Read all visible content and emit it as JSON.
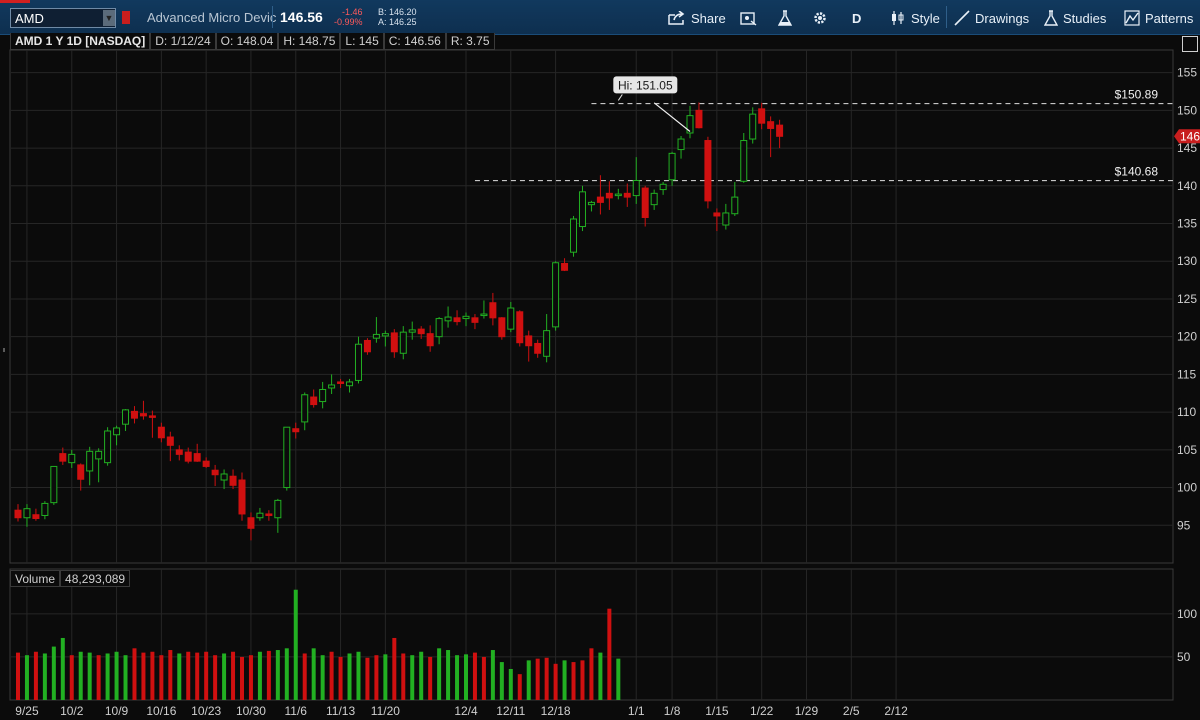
{
  "toolbar": {
    "symbol": "AMD",
    "description": "Advanced Micro Devic",
    "last": "146.56",
    "change": "-1.46",
    "change_pct": "-0.99%",
    "bid": "B: 146.20",
    "ask": "A: 146.25",
    "share_label": "Share",
    "aggregation_label": "D",
    "style_label": "Style",
    "drawings_label": "Drawings",
    "studies_label": "Studies",
    "patterns_label": "Patterns"
  },
  "info": {
    "title": "AMD 1 Y 1D [NASDAQ]",
    "date": "D: 1/12/24",
    "open": "O: 148.04",
    "high": "H: 148.75",
    "low": "L: 145",
    "close": "C: 146.56",
    "range": "R: 3.75"
  },
  "volume": {
    "label": "Volume",
    "value": "48,293,089"
  },
  "colors": {
    "up": "#22b022",
    "down": "#d01010",
    "grid": "#262626",
    "background": "#0b0b0b",
    "last_price_tag": "#c81e1e"
  },
  "chart_data": {
    "type": "candlestick",
    "price_ylim": [
      90,
      158
    ],
    "price_ticks": [
      95,
      100,
      105,
      110,
      115,
      120,
      125,
      130,
      135,
      140,
      145,
      150,
      155
    ],
    "volume_ylim": [
      0,
      130
    ],
    "volume_ticks": [
      50,
      100
    ],
    "x_tick_labels": [
      "9/25",
      "10/2",
      "10/9",
      "10/16",
      "10/23",
      "10/30",
      "11/6",
      "11/13",
      "11/20",
      "12/4",
      "12/11",
      "12/18",
      "1/1",
      "1/8",
      "1/15",
      "1/22",
      "1/29",
      "2/5",
      "2/12"
    ],
    "x_tick_index": [
      1,
      6,
      11,
      16,
      21,
      26,
      31,
      36,
      41,
      50,
      55,
      60,
      69,
      73,
      78,
      83,
      88,
      93,
      98
    ],
    "grid": true,
    "last_price_label": "146",
    "annotations": {
      "hi_label": "Hi: 151.05",
      "hi_value": 151.05,
      "hi_index": 67,
      "level_1_label": "$150.89",
      "level_1_value": 150.89,
      "level_1_start_index": 64,
      "level_2_label": "$140.68",
      "level_2_value": 140.68,
      "level_2_start_index": 51,
      "trendline": [
        [
          71,
          151.0
        ],
        [
          75,
          147.2
        ]
      ]
    },
    "candles": [
      {
        "o": 97.0,
        "h": 97.8,
        "l": 95.5,
        "c": 96.0
      },
      {
        "o": 96.0,
        "h": 97.8,
        "l": 94.8,
        "c": 97.2
      },
      {
        "o": 96.4,
        "h": 97.2,
        "l": 95.6,
        "c": 95.9
      },
      {
        "o": 96.3,
        "h": 98.2,
        "l": 95.8,
        "c": 97.9
      },
      {
        "o": 98.0,
        "h": 101.5,
        "l": 97.7,
        "c": 102.8
      },
      {
        "o": 104.5,
        "h": 105.3,
        "l": 103.0,
        "c": 103.5
      },
      {
        "o": 103.3,
        "h": 105.0,
        "l": 102.6,
        "c": 104.4
      },
      {
        "o": 103.0,
        "h": 103.2,
        "l": 99.6,
        "c": 101.1
      },
      {
        "o": 102.2,
        "h": 105.4,
        "l": 100.3,
        "c": 104.8
      },
      {
        "o": 103.8,
        "h": 105.2,
        "l": 100.7,
        "c": 104.8
      },
      {
        "o": 103.3,
        "h": 108.0,
        "l": 102.9,
        "c": 107.5
      },
      {
        "o": 107.0,
        "h": 108.2,
        "l": 105.6,
        "c": 107.9
      },
      {
        "o": 108.4,
        "h": 110.4,
        "l": 107.5,
        "c": 110.3
      },
      {
        "o": 110.1,
        "h": 110.8,
        "l": 108.5,
        "c": 109.2
      },
      {
        "o": 109.8,
        "h": 111.5,
        "l": 109.0,
        "c": 109.5
      },
      {
        "o": 109.5,
        "h": 110.2,
        "l": 106.6,
        "c": 109.4
      },
      {
        "o": 108.0,
        "h": 108.6,
        "l": 106.0,
        "c": 106.6
      },
      {
        "o": 106.7,
        "h": 107.4,
        "l": 103.5,
        "c": 105.6
      },
      {
        "o": 105.0,
        "h": 105.6,
        "l": 103.6,
        "c": 104.4
      },
      {
        "o": 104.7,
        "h": 105.3,
        "l": 103.2,
        "c": 103.5
      },
      {
        "o": 104.5,
        "h": 105.8,
        "l": 103.4,
        "c": 103.5
      },
      {
        "o": 103.5,
        "h": 104.0,
        "l": 102.6,
        "c": 102.8
      },
      {
        "o": 102.3,
        "h": 103.0,
        "l": 100.2,
        "c": 101.7
      },
      {
        "o": 101.0,
        "h": 102.4,
        "l": 99.8,
        "c": 101.8
      },
      {
        "o": 101.5,
        "h": 102.4,
        "l": 99.8,
        "c": 100.3
      },
      {
        "o": 101.0,
        "h": 102.0,
        "l": 95.6,
        "c": 96.5
      },
      {
        "o": 96.0,
        "h": 96.7,
        "l": 93.0,
        "c": 94.6
      },
      {
        "o": 96.0,
        "h": 97.3,
        "l": 95.6,
        "c": 96.6
      },
      {
        "o": 96.5,
        "h": 97.0,
        "l": 95.6,
        "c": 96.3
      },
      {
        "o": 96.0,
        "h": 98.5,
        "l": 94.0,
        "c": 98.3
      },
      {
        "o": 100.0,
        "h": 108.0,
        "l": 99.6,
        "c": 108.0
      },
      {
        "o": 107.8,
        "h": 108.6,
        "l": 106.5,
        "c": 107.4
      },
      {
        "o": 108.7,
        "h": 112.6,
        "l": 107.6,
        "c": 112.3
      },
      {
        "o": 112.0,
        "h": 113.0,
        "l": 110.6,
        "c": 111.0
      },
      {
        "o": 111.4,
        "h": 114.0,
        "l": 110.5,
        "c": 113.0
      },
      {
        "o": 113.2,
        "h": 115.0,
        "l": 112.4,
        "c": 113.6
      },
      {
        "o": 114.0,
        "h": 114.4,
        "l": 113.2,
        "c": 113.8
      },
      {
        "o": 113.5,
        "h": 114.4,
        "l": 112.6,
        "c": 114.0
      },
      {
        "o": 114.2,
        "h": 120.0,
        "l": 113.8,
        "c": 119.0
      },
      {
        "o": 119.5,
        "h": 119.8,
        "l": 117.6,
        "c": 118.0
      },
      {
        "o": 119.8,
        "h": 122.6,
        "l": 119.2,
        "c": 120.3
      },
      {
        "o": 120.1,
        "h": 120.8,
        "l": 118.7,
        "c": 120.4
      },
      {
        "o": 120.5,
        "h": 121.0,
        "l": 117.2,
        "c": 118.0
      },
      {
        "o": 117.8,
        "h": 121.4,
        "l": 117.0,
        "c": 120.6
      },
      {
        "o": 120.6,
        "h": 122.0,
        "l": 119.6,
        "c": 120.9
      },
      {
        "o": 121.0,
        "h": 121.4,
        "l": 119.7,
        "c": 120.4
      },
      {
        "o": 120.4,
        "h": 121.5,
        "l": 118.0,
        "c": 118.8
      },
      {
        "o": 120.0,
        "h": 122.6,
        "l": 119.0,
        "c": 122.4
      },
      {
        "o": 122.1,
        "h": 124.0,
        "l": 121.2,
        "c": 122.6
      },
      {
        "o": 122.5,
        "h": 123.5,
        "l": 121.5,
        "c": 122.0
      },
      {
        "o": 122.4,
        "h": 123.2,
        "l": 121.4,
        "c": 122.7
      },
      {
        "o": 122.5,
        "h": 123.0,
        "l": 121.0,
        "c": 121.9
      },
      {
        "o": 123.0,
        "h": 124.8,
        "l": 122.4,
        "c": 123.0
      },
      {
        "o": 124.5,
        "h": 125.8,
        "l": 121.5,
        "c": 122.5
      },
      {
        "o": 122.5,
        "h": 122.6,
        "l": 119.6,
        "c": 120.0
      },
      {
        "o": 121.0,
        "h": 124.6,
        "l": 120.6,
        "c": 123.8
      },
      {
        "o": 123.3,
        "h": 123.5,
        "l": 118.7,
        "c": 119.2
      },
      {
        "o": 120.1,
        "h": 120.8,
        "l": 116.7,
        "c": 118.8
      },
      {
        "o": 119.1,
        "h": 119.6,
        "l": 117.2,
        "c": 117.8
      },
      {
        "o": 117.4,
        "h": 123.0,
        "l": 116.6,
        "c": 120.8
      },
      {
        "o": 121.3,
        "h": 130.0,
        "l": 120.8,
        "c": 129.8
      },
      {
        "o": 129.7,
        "h": 130.4,
        "l": 128.7,
        "c": 128.8
      },
      {
        "o": 131.2,
        "h": 136.0,
        "l": 130.6,
        "c": 135.6
      },
      {
        "o": 134.6,
        "h": 140.0,
        "l": 134.0,
        "c": 139.2
      },
      {
        "o": 137.5,
        "h": 138.0,
        "l": 136.6,
        "c": 137.8
      },
      {
        "o": 138.5,
        "h": 141.4,
        "l": 136.2,
        "c": 137.8
      },
      {
        "o": 139.0,
        "h": 140.6,
        "l": 136.8,
        "c": 138.4
      },
      {
        "o": 138.7,
        "h": 139.6,
        "l": 138.2,
        "c": 138.9
      },
      {
        "o": 139.0,
        "h": 140.3,
        "l": 137.2,
        "c": 138.5
      },
      {
        "o": 138.7,
        "h": 143.8,
        "l": 137.6,
        "c": 140.7
      },
      {
        "o": 139.7,
        "h": 140.0,
        "l": 134.6,
        "c": 135.8
      },
      {
        "o": 137.5,
        "h": 139.5,
        "l": 136.8,
        "c": 139.0
      },
      {
        "o": 139.5,
        "h": 140.5,
        "l": 138.8,
        "c": 140.2
      },
      {
        "o": 140.8,
        "h": 144.5,
        "l": 140.0,
        "c": 144.3
      },
      {
        "o": 144.8,
        "h": 146.6,
        "l": 143.6,
        "c": 146.2
      },
      {
        "o": 147.0,
        "h": 150.6,
        "l": 146.3,
        "c": 149.3
      },
      {
        "o": 150.0,
        "h": 151.05,
        "l": 147.6,
        "c": 147.7
      },
      {
        "o": 146.0,
        "h": 146.5,
        "l": 137.0,
        "c": 138.0
      },
      {
        "o": 136.4,
        "h": 137.0,
        "l": 134.0,
        "c": 136.0
      },
      {
        "o": 134.8,
        "h": 137.6,
        "l": 134.2,
        "c": 136.4
      },
      {
        "o": 136.3,
        "h": 140.5,
        "l": 136.0,
        "c": 138.5
      },
      {
        "o": 140.6,
        "h": 147.0,
        "l": 140.4,
        "c": 146.0
      },
      {
        "o": 146.2,
        "h": 150.4,
        "l": 145.6,
        "c": 149.5
      },
      {
        "o": 150.2,
        "h": 151.0,
        "l": 147.5,
        "c": 148.3
      },
      {
        "o": 148.5,
        "h": 149.2,
        "l": 143.8,
        "c": 147.6
      },
      {
        "o": 148.04,
        "h": 148.75,
        "l": 145.0,
        "c": 146.56
      }
    ],
    "volumes": [
      55,
      52,
      56,
      54,
      62,
      72,
      52,
      56,
      55,
      52,
      54,
      56,
      52,
      60,
      55,
      56,
      52,
      58,
      54,
      56,
      55,
      56,
      52,
      54,
      56,
      50,
      52,
      56,
      57,
      58,
      60,
      128,
      54,
      60,
      52,
      56,
      50,
      54,
      56,
      49,
      52,
      53,
      72,
      54,
      52,
      56,
      50,
      60,
      58,
      52,
      53,
      55,
      50,
      58,
      44,
      36,
      30,
      46,
      48,
      49,
      42,
      46,
      44,
      46,
      60,
      55,
      106,
      48
    ],
    "volume_dir": [
      -1,
      1,
      -1,
      1,
      1,
      1,
      -1,
      1,
      1,
      -1,
      1,
      1,
      1,
      -1,
      -1,
      -1,
      -1,
      -1,
      1,
      -1,
      -1,
      -1,
      -1,
      1,
      -1,
      -1,
      -1,
      1,
      -1,
      1,
      1,
      1,
      -1,
      1,
      1,
      -1,
      -1,
      1,
      1,
      -1,
      -1,
      1,
      -1,
      -1,
      1,
      1,
      -1,
      1,
      1,
      1,
      1,
      -1,
      -1,
      1,
      1,
      1,
      -1,
      1,
      -1,
      -1,
      -1,
      1,
      -1,
      -1,
      -1,
      1,
      -1
    ]
  }
}
